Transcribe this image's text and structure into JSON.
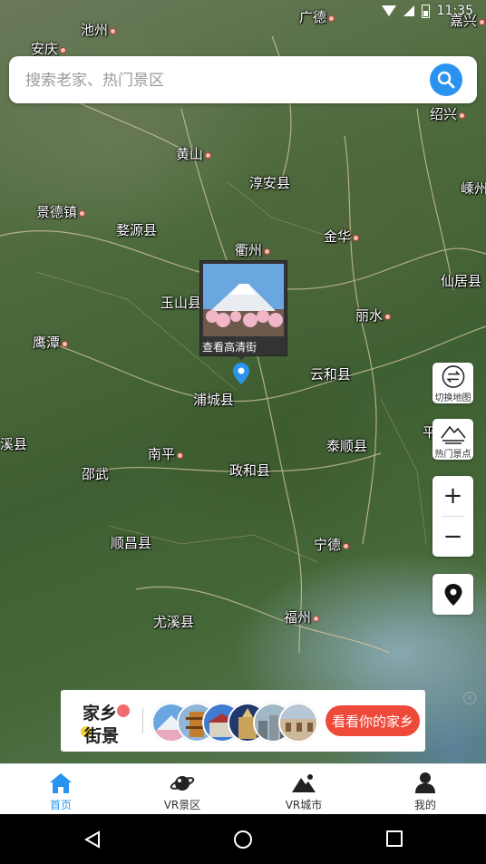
{
  "search": {
    "placeholder": "搜索老家、热门景区",
    "button_icon": "search-icon"
  },
  "status_bar": {
    "time": "11:35"
  },
  "map": {
    "cities": [
      {
        "name": "池州",
        "dot": true
      },
      {
        "name": "安庆",
        "dot": true
      },
      {
        "name": "广德",
        "dot": true
      },
      {
        "name": "嘉兴",
        "dot": true
      },
      {
        "name": "绍兴",
        "dot": true
      },
      {
        "name": "黄山",
        "dot": true
      },
      {
        "name": "淳安县",
        "dot": false
      },
      {
        "name": "景德镇",
        "dot": true
      },
      {
        "name": "婺源县",
        "dot": false
      },
      {
        "name": "衢州",
        "dot": true
      },
      {
        "name": "金华",
        "dot": true
      },
      {
        "name": "嵊州",
        "dot": false
      },
      {
        "name": "仙居县",
        "dot": false
      },
      {
        "name": "玉山县",
        "dot": false
      },
      {
        "name": "丽水",
        "dot": true
      },
      {
        "name": "鹰潭",
        "dot": true
      },
      {
        "name": "云和县",
        "dot": false
      },
      {
        "name": "浦城县",
        "dot": false
      },
      {
        "name": "泰顺县",
        "dot": false
      },
      {
        "name": "南平",
        "dot": true
      },
      {
        "name": "邵武",
        "dot": false
      },
      {
        "name": "政和县",
        "dot": false
      },
      {
        "name": "顺昌县",
        "dot": false
      },
      {
        "name": "宁德",
        "dot": true
      },
      {
        "name": "尤溪县",
        "dot": false
      },
      {
        "name": "福州",
        "dot": true
      },
      {
        "name": "溪县",
        "dot": false
      },
      {
        "name": "平",
        "dot": false
      }
    ],
    "popup": {
      "label": "查看高清街"
    }
  },
  "tools": {
    "switch_map": "切换地图",
    "hot_spots": "热门景点",
    "zoom_in": "+",
    "zoom_out": "−"
  },
  "banner": {
    "brand_line1": "家乡",
    "brand_line2": "街景",
    "cta": "看看你的家乡",
    "close": "×"
  },
  "tabs": [
    {
      "label": "首页",
      "icon": "home-icon",
      "active": true
    },
    {
      "label": "VR景区",
      "icon": "planet-icon",
      "active": false
    },
    {
      "label": "VR城市",
      "icon": "mountain-icon",
      "active": false
    },
    {
      "label": "我的",
      "icon": "user-icon",
      "active": false
    }
  ],
  "colors": {
    "accent": "#2a93f0",
    "cta": "#ee4a3a"
  }
}
